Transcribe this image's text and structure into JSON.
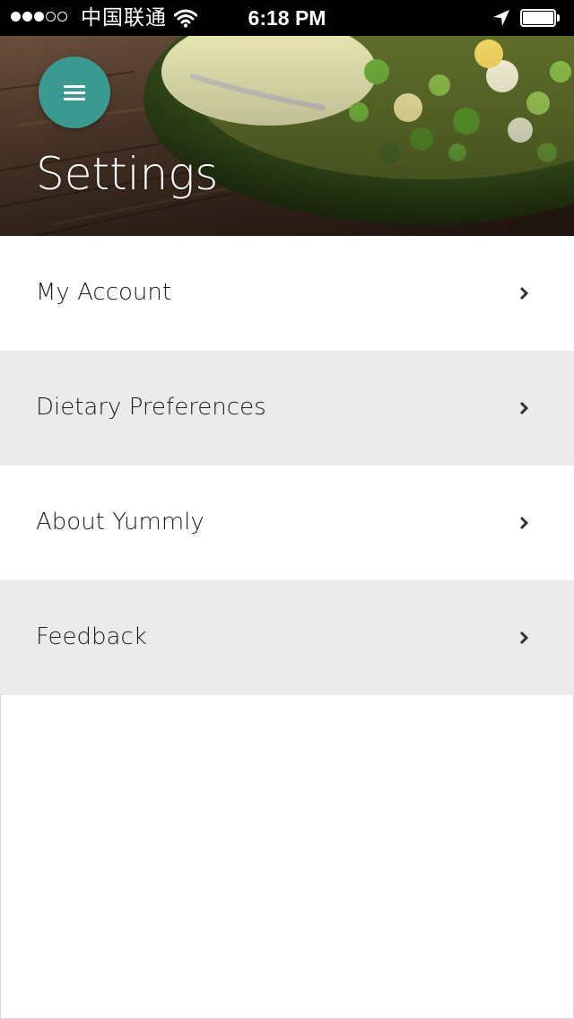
{
  "status_bar": {
    "carrier": "中国联通",
    "time": "6:18 PM",
    "signal_bars": 3,
    "signal_total": 5,
    "battery_level": 1.0,
    "icons": [
      "signal-dots-icon",
      "wifi-icon",
      "location-arrow-icon",
      "battery-icon"
    ]
  },
  "header": {
    "title": "Settings",
    "menu_icon": "hamburger-menu-icon",
    "accent_color": "#3a9a91"
  },
  "settings": {
    "items": [
      {
        "label": "My Account",
        "icon": "chevron-right-icon"
      },
      {
        "label": "Dietary Preferences",
        "icon": "chevron-right-icon"
      },
      {
        "label": "About Yummly",
        "icon": "chevron-right-icon"
      },
      {
        "label": "Feedback",
        "icon": "chevron-right-icon"
      }
    ]
  },
  "colors": {
    "row_alt": "#ebebeb",
    "row_plain": "#ffffff",
    "text": "#1e1e1e"
  }
}
